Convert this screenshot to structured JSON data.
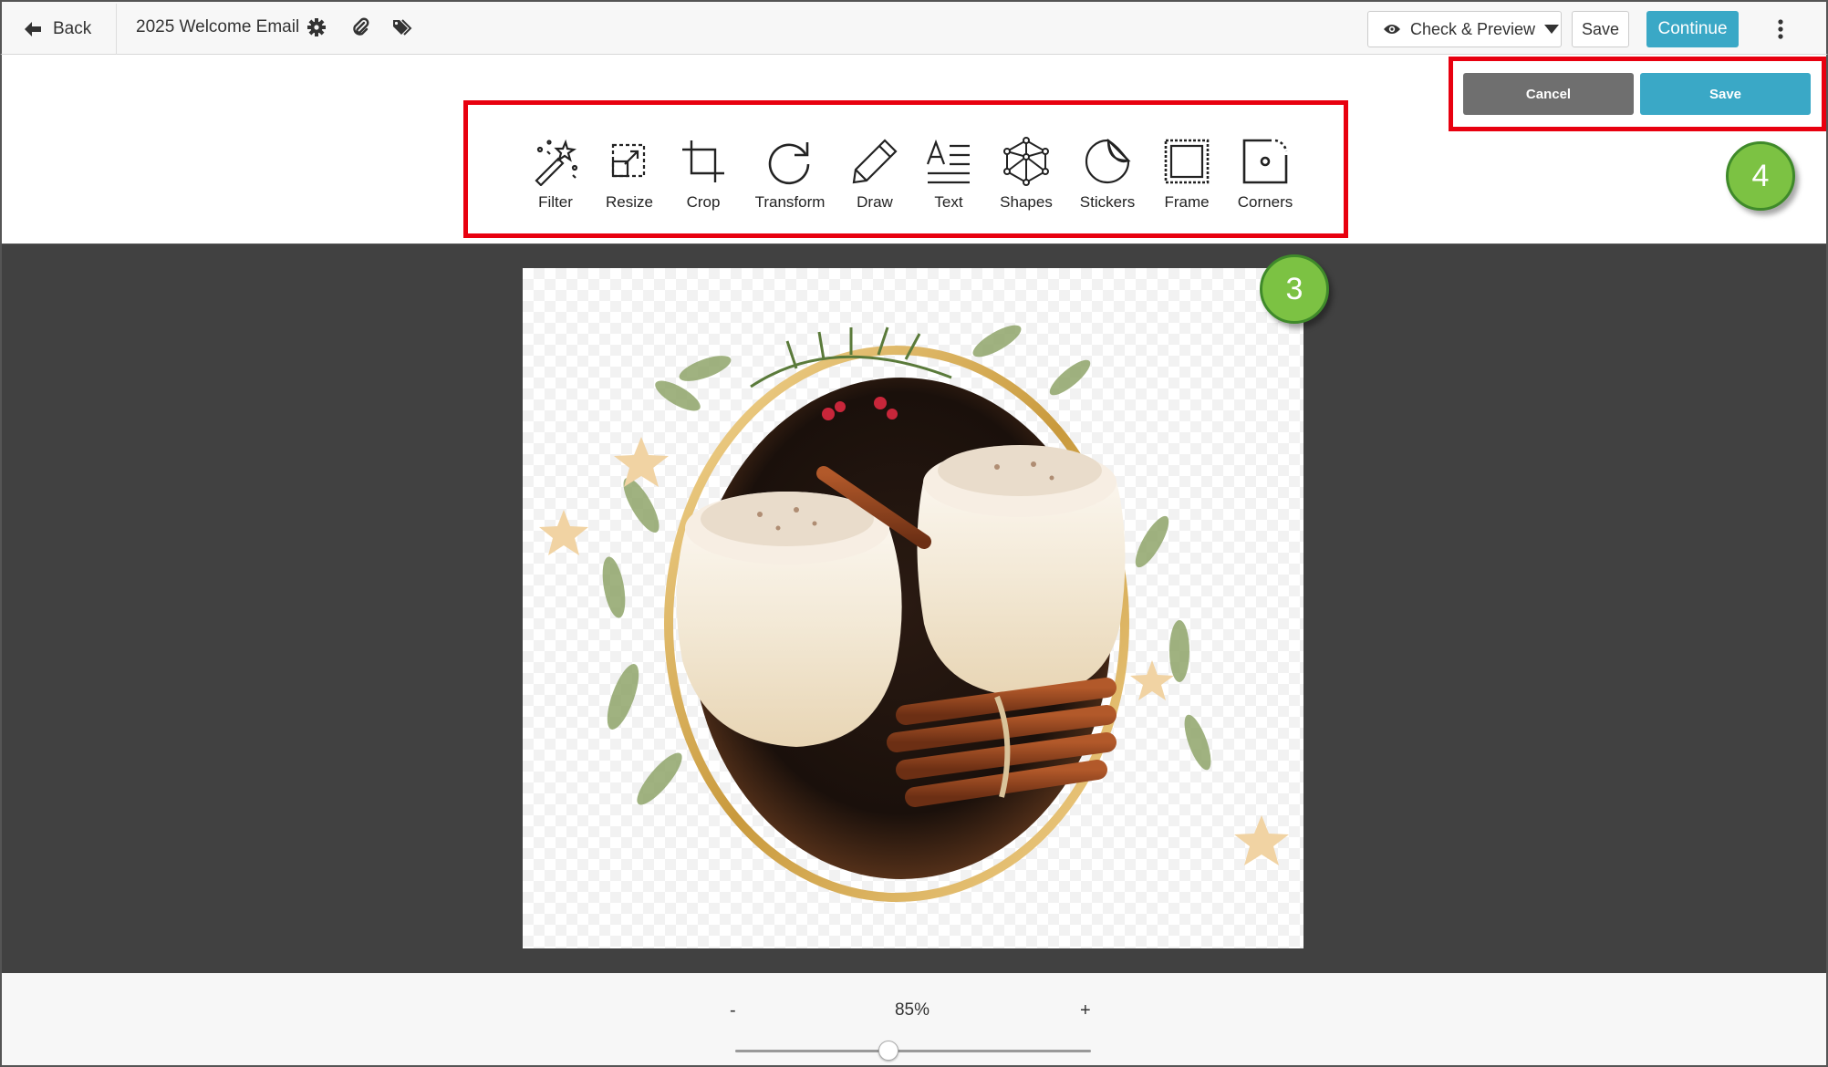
{
  "topbar": {
    "back_label": "Back",
    "document_title": "2025 Welcome Email",
    "preview_label": "Check & Preview",
    "save_label": "Save",
    "continue_label": "Continue"
  },
  "toolbar": {
    "tools": [
      {
        "label": "Filter",
        "icon": "magic-wand-icon"
      },
      {
        "label": "Resize",
        "icon": "resize-icon"
      },
      {
        "label": "Crop",
        "icon": "crop-icon"
      },
      {
        "label": "Transform",
        "icon": "rotate-icon"
      },
      {
        "label": "Draw",
        "icon": "pencil-icon"
      },
      {
        "label": "Text",
        "icon": "text-icon"
      },
      {
        "label": "Shapes",
        "icon": "shapes-icon"
      },
      {
        "label": "Stickers",
        "icon": "sticker-icon"
      },
      {
        "label": "Frame",
        "icon": "frame-icon"
      },
      {
        "label": "Corners",
        "icon": "corners-icon"
      }
    ]
  },
  "editor_actions": {
    "cancel_label": "Cancel",
    "save_label": "Save"
  },
  "steps": {
    "canvas_step": "3",
    "actions_step": "4"
  },
  "zoom": {
    "minus_label": "-",
    "plus_label": "+",
    "value_label": "85%",
    "slider_level": 0.43
  },
  "colors": {
    "accent": "#3aa8c6",
    "cancel": "#6f6f6f",
    "highlight": "#e8000f",
    "step_badge": "#7cc243",
    "canvas_bg": "#414141"
  }
}
